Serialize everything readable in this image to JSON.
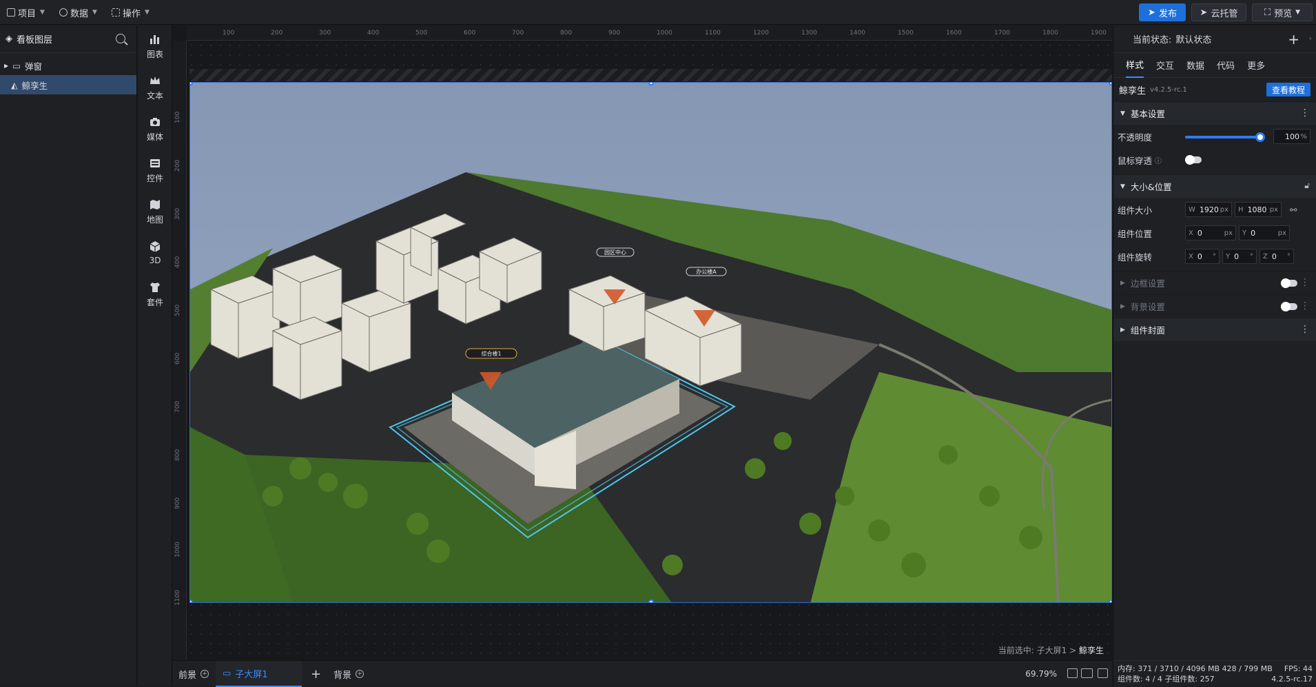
{
  "topbar": {
    "menus": [
      {
        "label": "项目"
      },
      {
        "label": "数据"
      },
      {
        "label": "操作"
      }
    ],
    "publish": "发布",
    "cloud": "云托管",
    "preview": "预览"
  },
  "layers": {
    "title": "看板图层",
    "items": [
      {
        "label": "弹窗"
      },
      {
        "label": "鲸孪生"
      }
    ]
  },
  "iconbar": {
    "items": [
      {
        "label": "图表"
      },
      {
        "label": "文本"
      },
      {
        "label": "媒体"
      },
      {
        "label": "控件"
      },
      {
        "label": "地图"
      },
      {
        "label": "3D"
      },
      {
        "label": "套件"
      }
    ]
  },
  "ruler": {
    "top": [
      "100",
      "200",
      "300",
      "400",
      "500",
      "600",
      "700",
      "800",
      "900",
      "1000",
      "1100",
      "1200",
      "1300",
      "1400",
      "1500",
      "1600",
      "1700",
      "1800",
      "1900"
    ],
    "left": [
      "100",
      "200",
      "300",
      "400",
      "500",
      "600",
      "700",
      "800",
      "900",
      "1000",
      "1100"
    ]
  },
  "canvas": {
    "current_prefix": "当前选中:",
    "current_path": "子大屏1 >",
    "current_name": "鲸孪生",
    "labels": [
      "园区中心",
      "办公楼A",
      "综合楼1"
    ]
  },
  "bottombar": {
    "tab_front": "前景",
    "tab_sub": "子大屏1",
    "tab_bg": "背景",
    "zoom": "69.79%"
  },
  "panel": {
    "status_label": "当前状态:",
    "status_value": "默认状态",
    "tabs": [
      "样式",
      "交互",
      "数据",
      "代码",
      "更多"
    ],
    "component_name": "鲸孪生",
    "component_version": "v4.2.5-rc.1",
    "tutorial": "查看教程",
    "sections": {
      "basic": "基本设置",
      "size": "大小&位置",
      "border": "边框设置",
      "background": "背景设置",
      "cover": "组件封面"
    },
    "opacity_label": "不透明度",
    "opacity_value": "100",
    "opacity_unit": "%",
    "opacity_fraction": 1.0,
    "mouse_label": "鼠标穿透",
    "size_label": "组件大小",
    "w_pre": "W",
    "w": "1920",
    "h_pre": "H",
    "h": "1080",
    "px": "px",
    "pos_label": "组件位置",
    "x_pre": "X",
    "x": "0",
    "y_pre": "Y",
    "y": "0",
    "rot_label": "组件旋转",
    "rx": "0",
    "ry": "0",
    "z_pre": "Z",
    "rz": "0",
    "deg": "°",
    "stats_mem": "内存: 371 / 3710 / 4096 MB  428 / 799 MB",
    "stats_fps": "FPS: 44",
    "stats_count": "组件数: 4 / 4   子组件数: 257",
    "stats_ver": "4.2.5-rc.17"
  },
  "colors": {
    "accent": "#1e6fd9",
    "selection": "#2d7bf0",
    "sky": "#8ea0bd",
    "grass": "#5f8b33",
    "road": "#2a2b2d"
  }
}
